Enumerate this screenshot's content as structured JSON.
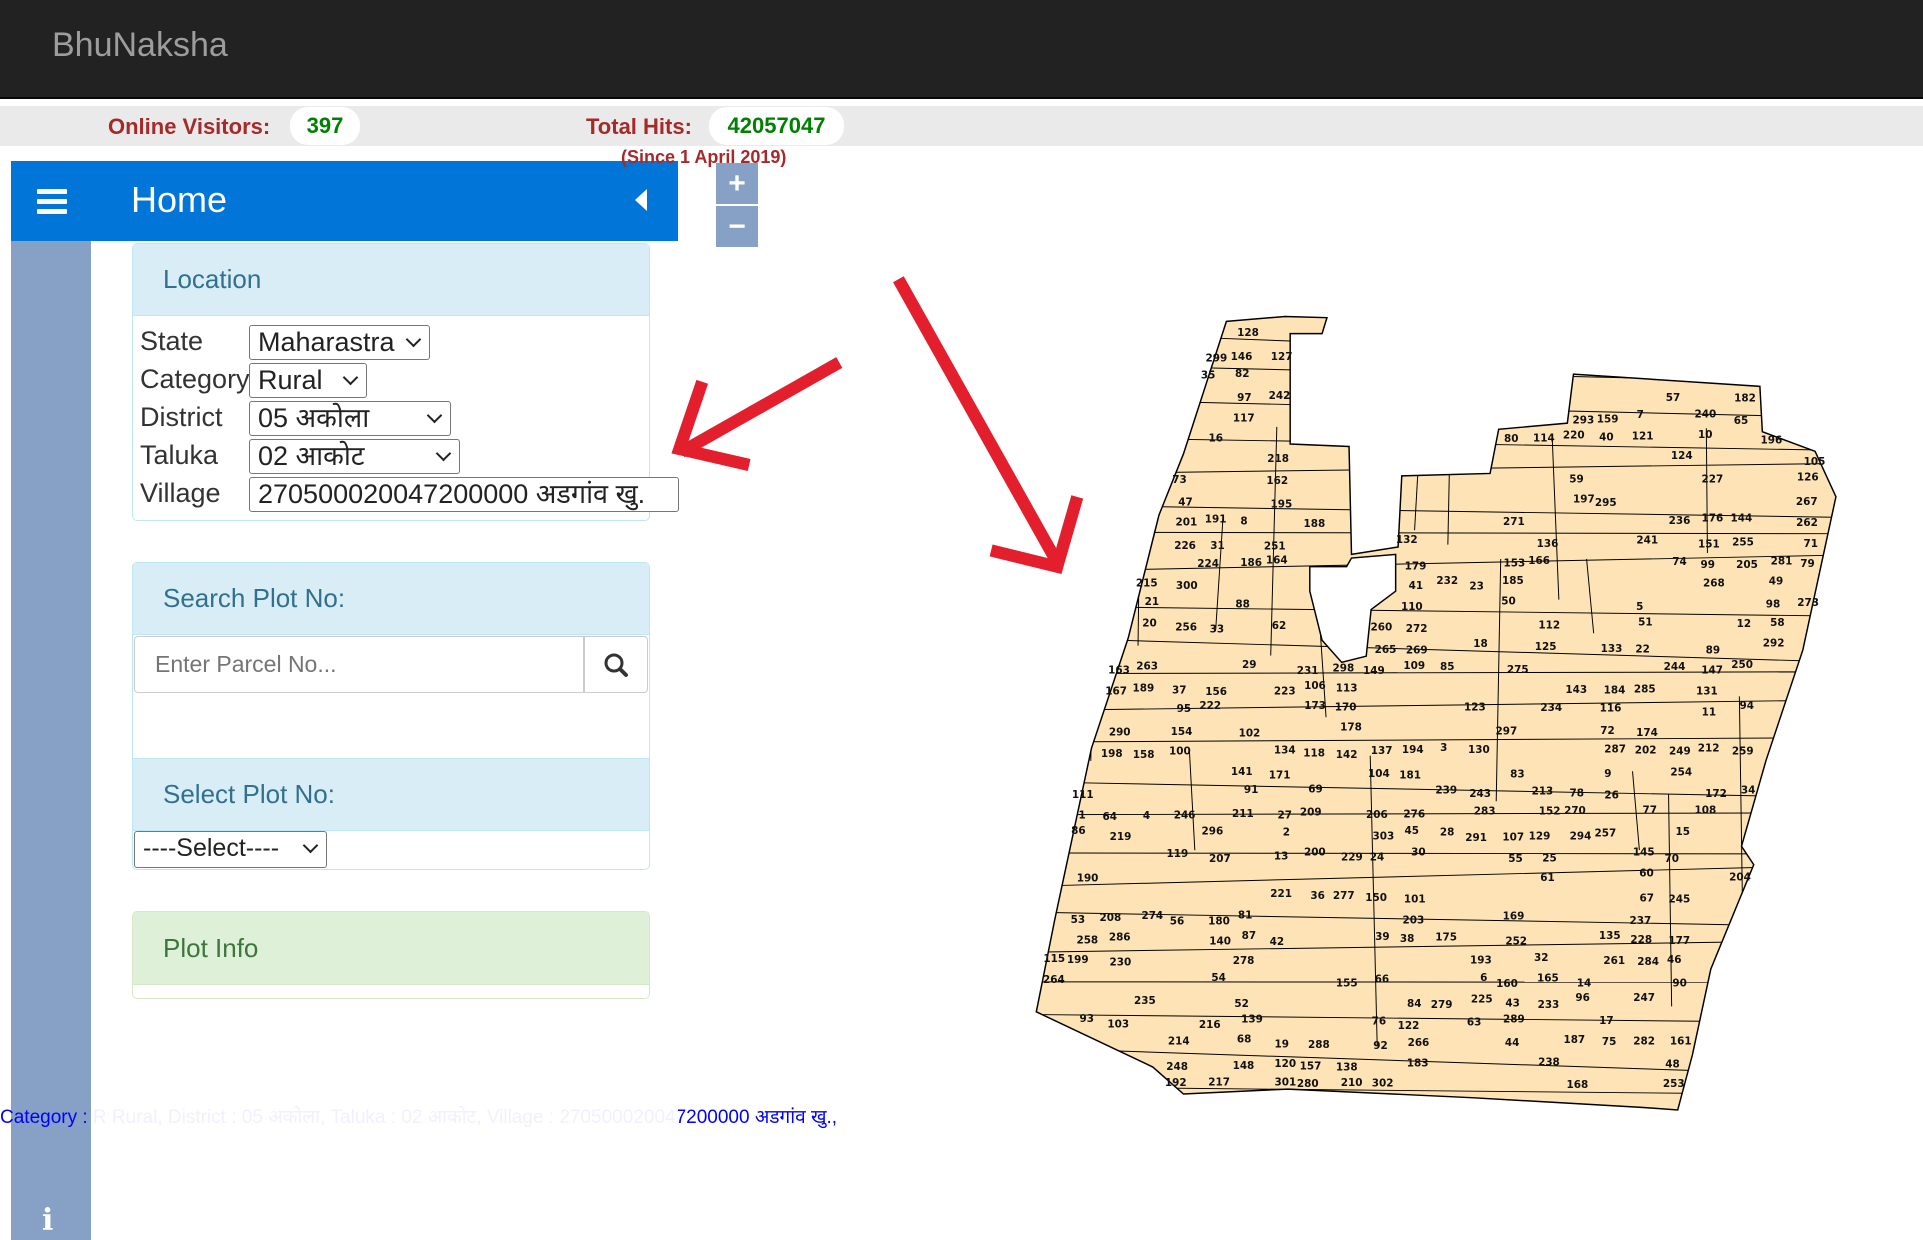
{
  "app": {
    "title": "BhuNaksha"
  },
  "stats": {
    "online_label": "Online Visitors:",
    "online_value": "397",
    "hits_label": "Total Hits:",
    "hits_value": "42057047",
    "since": "(Since 1 April 2019)"
  },
  "header": {
    "title": "Home",
    "menu_icon": "hamburger-icon",
    "collapse_icon": "caret-left-icon"
  },
  "zoom": {
    "in": "+",
    "out": "−"
  },
  "location": {
    "title": "Location",
    "fields": [
      {
        "label": "State",
        "value": "Maharastra"
      },
      {
        "label": "Category",
        "value": "Rural"
      },
      {
        "label": "District",
        "value": "05 अकोला"
      },
      {
        "label": "Taluka",
        "value": "02 आकोट"
      },
      {
        "label": "Village",
        "value": "270500020047200000 अडगांव खु."
      }
    ]
  },
  "search": {
    "title": "Search Plot No:",
    "placeholder": "Enter Parcel No...",
    "icon": "search-icon"
  },
  "select_plot": {
    "title": "Select Plot No:",
    "value": "----Select----"
  },
  "plot_info": {
    "title": "Plot Info"
  },
  "status_line": "Category : R Rural, District : 05 अकोला, Taluka : 02 आकोट, Village : 270500020047200000 अडगांव खु.,",
  "colors": {
    "accent": "#0275d8",
    "sidebar": "#86a0c6",
    "parcel_fill": "#fde3b6",
    "arrow": "#e31e2d",
    "label_red": "#a52a2a",
    "value_green": "#008000"
  },
  "map": {
    "plot_numbers": [
      1,
      2,
      3,
      4,
      5,
      6,
      7,
      8,
      9,
      10,
      11,
      12,
      13,
      14,
      15,
      16,
      17,
      18,
      19,
      20,
      21,
      22,
      23,
      24,
      25,
      26,
      27,
      28,
      29,
      30,
      31,
      32,
      33,
      34,
      35,
      36,
      37,
      38,
      39,
      40,
      41,
      42,
      43,
      44,
      45,
      46,
      47,
      48,
      49,
      50,
      51,
      52,
      53,
      54,
      55,
      56,
      57,
      58,
      59,
      60,
      61,
      62,
      63,
      64,
      65,
      66,
      67,
      68,
      69,
      70,
      71,
      72,
      73,
      74,
      75,
      76,
      77,
      78,
      79,
      80,
      81,
      82,
      83,
      84,
      85,
      86,
      87,
      88,
      89,
      90,
      91,
      92,
      93,
      94,
      95,
      96,
      97,
      98,
      99,
      100,
      101,
      102,
      103,
      104,
      105,
      106,
      107,
      108,
      109,
      110,
      111,
      112,
      113,
      114,
      115,
      116,
      117,
      118,
      119,
      120,
      121,
      122,
      123,
      124,
      125,
      126,
      127,
      128,
      129,
      130,
      131,
      132,
      133,
      134,
      135,
      136,
      137,
      138,
      139,
      140,
      141,
      142,
      143,
      144,
      145,
      146,
      147,
      148,
      149,
      150,
      151,
      152,
      153,
      154,
      155,
      156,
      157,
      158,
      159,
      160,
      161,
      162,
      163,
      164,
      165,
      166,
      167,
      168,
      169,
      170,
      171,
      172,
      173,
      174,
      175,
      176,
      177,
      178,
      179,
      180,
      181,
      182,
      183,
      184,
      185,
      186,
      187,
      188,
      189,
      190,
      191,
      192,
      193,
      194,
      195,
      196,
      197,
      198,
      199,
      200,
      201,
      202,
      203,
      204,
      205,
      206,
      207,
      208,
      209,
      210,
      211,
      212,
      213,
      214,
      215,
      216,
      217,
      218,
      219,
      220,
      221,
      222,
      223,
      224,
      225,
      226,
      227,
      228,
      229,
      230,
      231,
      232,
      233,
      234,
      235,
      236,
      237,
      238,
      239,
      240,
      241,
      242,
      243,
      244,
      245,
      246,
      247,
      248,
      249,
      250,
      251,
      252,
      253,
      254,
      255,
      256,
      257,
      258,
      259,
      260,
      261,
      262,
      263,
      264,
      265,
      266,
      267,
      268,
      269,
      270,
      271,
      272,
      273,
      274,
      275,
      276,
      277,
      278,
      279,
      280,
      281,
      282,
      283,
      284,
      285,
      286,
      287,
      288,
      289,
      290,
      291,
      292,
      293,
      294,
      295,
      296,
      297,
      298,
      299,
      300,
      301,
      302,
      303
    ]
  }
}
